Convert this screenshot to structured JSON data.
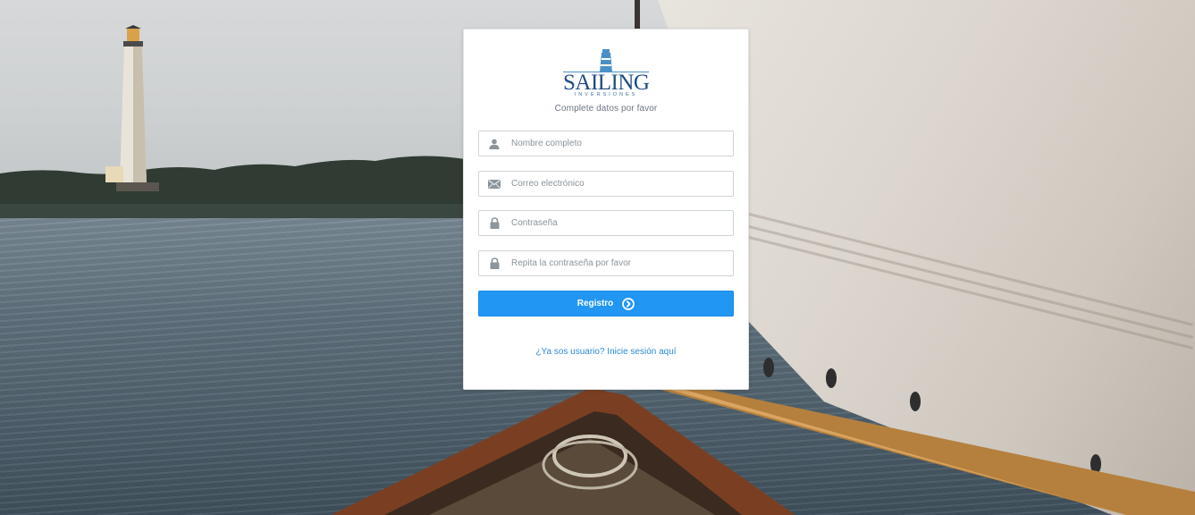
{
  "brand": {
    "name": "SAILING",
    "tagline": "INVERSIONES",
    "accent_color": "#1f4d82"
  },
  "form": {
    "subtitle": "Complete datos por favor",
    "fields": {
      "full_name": {
        "placeholder": "Nombre completo",
        "icon": "user-icon",
        "value": ""
      },
      "email": {
        "placeholder": "Correo electrónico",
        "icon": "envelope-icon",
        "value": ""
      },
      "password": {
        "placeholder": "Contraseña",
        "icon": "lock-icon",
        "value": ""
      },
      "password_repeat": {
        "placeholder": "Repita la contraseña por favor",
        "icon": "lock-icon",
        "value": ""
      }
    },
    "submit": {
      "label": "Registro",
      "icon": "arrow-circle-right-icon",
      "color": "#2196f3"
    },
    "login_link": "¿Ya sos usuario? Inicie sesión aquí"
  }
}
